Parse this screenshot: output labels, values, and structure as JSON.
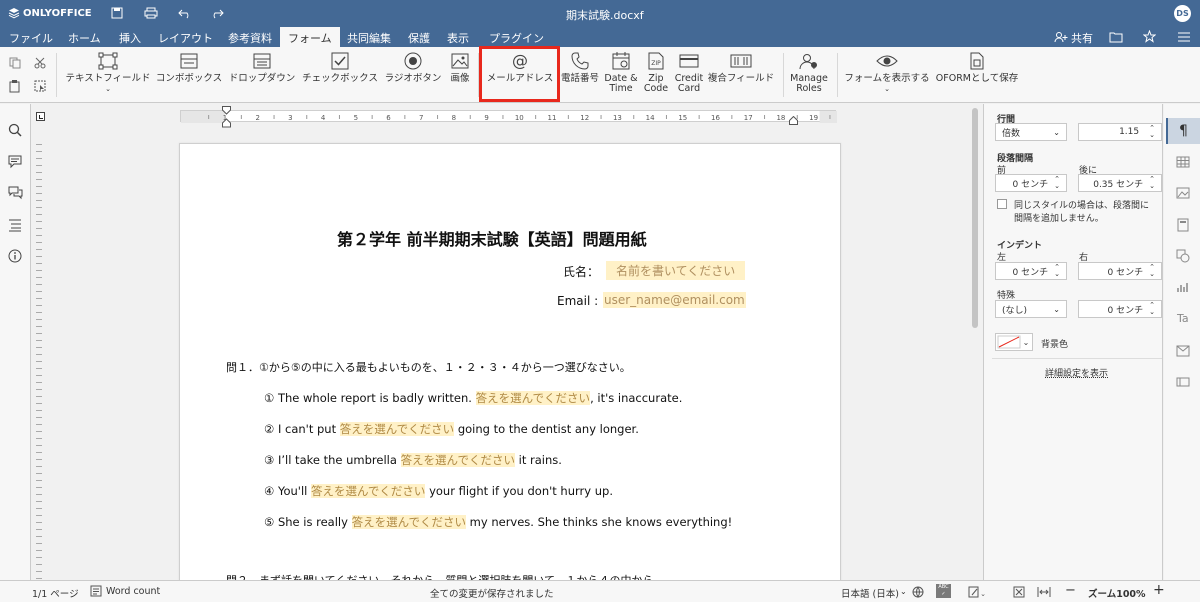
{
  "app": {
    "logo": "ONLYOFFICE",
    "title": "期末試験.docxf",
    "user_initials": "DS",
    "share_label": "共有"
  },
  "tabs": [
    "ファイル",
    "ホーム",
    "挿入",
    "レイアウト",
    "参考資料",
    "フォーム",
    "共同編集",
    "保護",
    "表示",
    "プラグイン"
  ],
  "active_tab": "フォーム",
  "ribbon": {
    "text_field": "テキストフィールド",
    "combo_box": "コンボボックス",
    "dropdown": "ドロップダウン",
    "checkbox": "チェックボックス",
    "radio": "ラジオボタン",
    "image": "画像",
    "email": "メールアドレス",
    "phone": "電話番号",
    "date_l1": "Date &",
    "date_l2": "Time",
    "zip_l1": "Zip",
    "zip_l2": "Code",
    "card_l1": "Credit",
    "card_l2": "Card",
    "complex": "複合フィールド",
    "roles_l1": "Manage",
    "roles_l2": "Roles",
    "view_form": "フォームを表示する",
    "save_oform": "OFORMとして保存"
  },
  "highlight_color": "#e8281c",
  "ruler": {
    "numbers": [
      "1",
      "2",
      "3",
      "4",
      "5",
      "6",
      "7",
      "8",
      "9",
      "10",
      "11",
      "12",
      "13",
      "14",
      "15",
      "16",
      "17",
      "18",
      "19"
    ]
  },
  "document": {
    "title": "第２学年  前半期期末試験【英語】問題用紙",
    "name_label": "氏名：",
    "name_placeholder": "名前を書いてください",
    "email_label": "Email :",
    "email_placeholder": "user_name@email.com",
    "q1": "問１．①から⑤の中に入る最もよいものを、１・２・３・４から一つ選びなさい。",
    "answer_ph": "答えを選んでください",
    "items": [
      {
        "pre": "① The whole report is badly written. ",
        "post": ", it's inaccurate."
      },
      {
        "pre": "② I can't put ",
        "post": " going to the dentist any longer."
      },
      {
        "pre": "③ I’ll take the umbrella ",
        "post": " it rains."
      },
      {
        "pre": "④ You'll ",
        "post": " your flight if you don't hurry up."
      },
      {
        "pre": "⑤ She is really ",
        "post": " my nerves. She thinks she knows everything!"
      }
    ],
    "q2_partial": "問２．まず話を聞いてください。それから、質問と選択肢を聞いて、１から４の中から"
  },
  "panel": {
    "line_spacing": "行間",
    "ls_mode": "倍数",
    "ls_value": "1.15",
    "para_spacing": "段落間隔",
    "before": "前",
    "after": "後に",
    "before_value": "0 センチ",
    "after_value": "0.35 センチ",
    "same_style": "同じスタイルの場合は、段落間に",
    "same_style2": "間隔を追加しません。",
    "indent": "インデント",
    "left": "左",
    "right": "右",
    "left_value": "0 センチ",
    "right_value": "0 センチ",
    "special": "特殊",
    "special_value": "(なし)",
    "special_cm": "0 センチ",
    "bg_color": "背景色",
    "advanced": "詳細設定を表示"
  },
  "status": {
    "page": "1/1 ページ",
    "word_count": "Word count",
    "saved": "全ての変更が保存されました",
    "language": "日本語 (日本)",
    "zoom": "ズーム100%"
  }
}
